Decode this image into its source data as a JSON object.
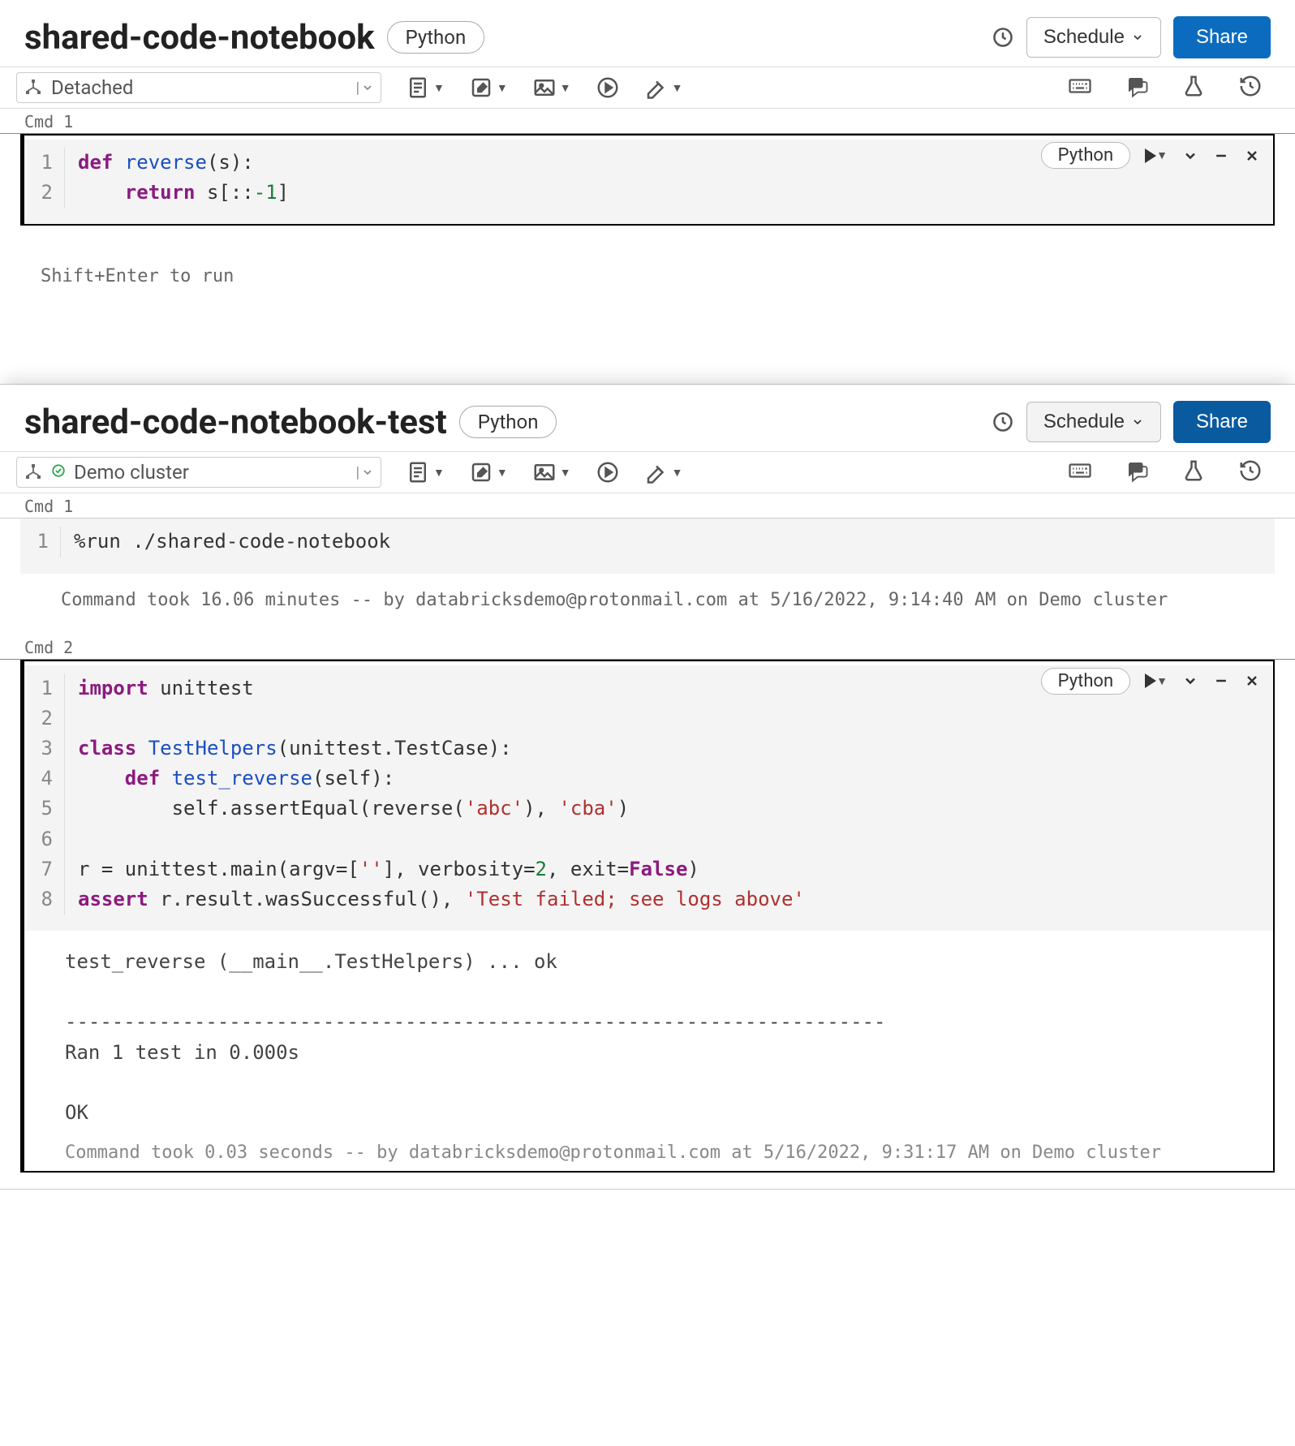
{
  "notebook1": {
    "title": "shared-code-notebook",
    "language": "Python",
    "schedule_label": "Schedule",
    "share_label": "Share",
    "cluster": "Detached",
    "cmd1_label": "Cmd 1",
    "cell_lang": "Python",
    "code": {
      "gutter": [
        "1",
        "2"
      ],
      "line1_kw": "def",
      "line1_fn": " reverse",
      "line1_rest": "(s):",
      "line2_kw": "    return",
      "line2_rest": " s[::",
      "line2_num": "-1",
      "line2_end": "]"
    },
    "hint": "Shift+Enter to run"
  },
  "notebook2": {
    "title": "shared-code-notebook-test",
    "language": "Python",
    "schedule_label": "Schedule",
    "share_label": "Share",
    "cluster": "Demo cluster",
    "cmd1_label": "Cmd 1",
    "cmd2_label": "Cmd 2",
    "cell1": {
      "gutter": [
        "1"
      ],
      "line1": "%run ./shared-code-notebook",
      "status": "Command took 16.06 minutes -- by databricksdemo@protonmail.com at 5/16/2022, 9:14:40 AM on Demo cluster"
    },
    "cell2": {
      "lang": "Python",
      "gutter": [
        "1",
        "2",
        "3",
        "4",
        "5",
        "6",
        "7",
        "8"
      ],
      "l1_kw": "import",
      "l1_rest": " unittest",
      "l3_kw": "class",
      "l3_fn": " TestHelpers",
      "l3_rest": "(unittest.TestCase):",
      "l4_kw": "    def",
      "l4_fn": " test_reverse",
      "l4_rest": "(self):",
      "l5_a": "        self.assertEqual(reverse(",
      "l5_s1": "'abc'",
      "l5_b": "), ",
      "l5_s2": "'cba'",
      "l5_c": ")",
      "l7_a": "r = unittest.main(argv=[",
      "l7_s1": "''",
      "l7_b": "], verbosity=",
      "l7_n": "2",
      "l7_c": ", exit=",
      "l7_bool": "False",
      "l7_d": ")",
      "l8_kw": "assert",
      "l8_a": " r.result.wasSuccessful(), ",
      "l8_s": "'Test failed; see logs above'",
      "output": "test_reverse (__main__.TestHelpers) ... ok\n\n----------------------------------------------------------------------\nRan 1 test in 0.000s\n\nOK",
      "status": "Command took 0.03 seconds -- by databricksdemo@protonmail.com at 5/16/2022, 9:31:17 AM on Demo cluster"
    }
  }
}
